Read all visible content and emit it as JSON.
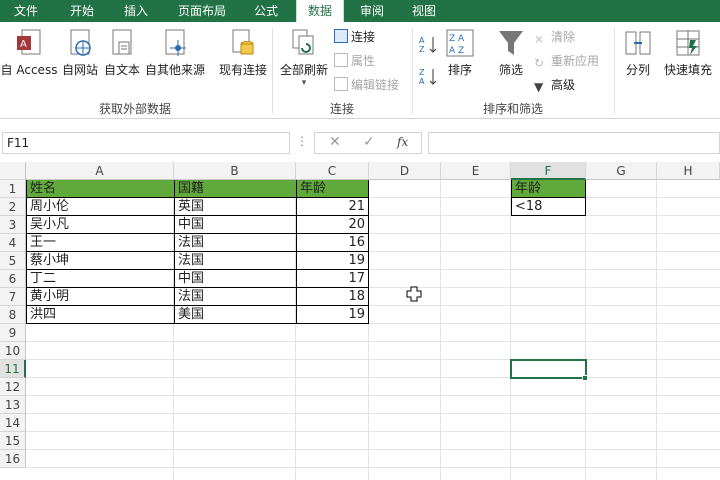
{
  "tabs": [
    "文件",
    "开始",
    "插入",
    "页面布局",
    "公式",
    "数据",
    "审阅",
    "视图"
  ],
  "ribbon": {
    "groups": {
      "external": "获取外部数据",
      "connections": "连接",
      "sortfilter": "排序和筛选"
    },
    "buttons": {
      "access": "自 Access",
      "web": "自网站",
      "text": "自文本",
      "other": "自其他来源",
      "existing": "现有连接",
      "refresh": "全部刷新",
      "sort": "排序",
      "filter": "筛选",
      "split": "分列",
      "flash": "快速填充"
    },
    "small": {
      "conn": "连接",
      "props": "属性",
      "editlinks": "编辑链接",
      "clear": "清除",
      "reapply": "重新应用",
      "advanced": "高级"
    }
  },
  "namebox": "F11",
  "fx": "fx",
  "columns": [
    "A",
    "B",
    "C",
    "D",
    "E",
    "F",
    "G",
    "H"
  ],
  "rows": [
    "1",
    "2",
    "3",
    "4",
    "5",
    "6",
    "7",
    "8",
    "9",
    "10",
    "11",
    "12",
    "13",
    "14",
    "15",
    "16"
  ],
  "table": {
    "headers": [
      "姓名",
      "国籍",
      "年龄"
    ],
    "rows": [
      [
        "周小伦",
        "英国",
        "21"
      ],
      [
        "吴小凡",
        "中国",
        "20"
      ],
      [
        "王一",
        "法国",
        "16"
      ],
      [
        "蔡小坤",
        "法国",
        "19"
      ],
      [
        "丁二",
        "中国",
        "17"
      ],
      [
        "黄小明",
        "法国",
        "18"
      ],
      [
        "洪四",
        "美国",
        "19"
      ]
    ]
  },
  "criteria": {
    "header": "年龄",
    "value": "<18"
  },
  "colors": {
    "excel_green": "#217346",
    "header_fill": "#5faa3a"
  }
}
